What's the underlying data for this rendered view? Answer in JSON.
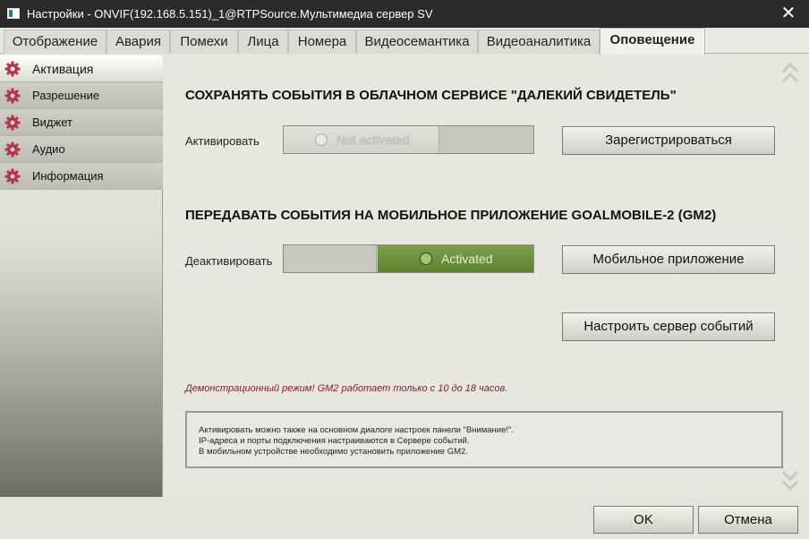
{
  "window": {
    "title": "Настройки - ONVIF(192.168.5.151)_1@RTPSource.Мультимедиа сервер SV",
    "close": "✕"
  },
  "tabs": [
    {
      "label": "Отображение"
    },
    {
      "label": "Авария"
    },
    {
      "label": "Помехи"
    },
    {
      "label": "Лица"
    },
    {
      "label": "Номера"
    },
    {
      "label": "Видеосемантика"
    },
    {
      "label": "Видеоаналитика"
    },
    {
      "label": "Оповещение",
      "active": true
    }
  ],
  "sidebar": {
    "items": [
      {
        "label": "Активация",
        "icon": "gear-icon",
        "active": true
      },
      {
        "label": "Разрешение",
        "icon": "gear-icon"
      },
      {
        "label": "Виджет",
        "icon": "gear-icon"
      },
      {
        "label": "Аудио",
        "icon": "gear-icon"
      },
      {
        "label": "Информация",
        "icon": "gear-icon"
      }
    ]
  },
  "main": {
    "cloud": {
      "title": "СОХРАНЯТЬ СОБЫТИЯ В ОБЛАЧНОМ СЕРВИСЕ \"ДАЛЕКИЙ СВИДЕТЕЛЬ\"",
      "row_label": "Активировать",
      "toggle_text": "Not activated",
      "button": "Зарегистрироваться"
    },
    "mobile": {
      "title": "ПЕРЕДАВАТЬ СОБЫТИЯ НА МОБИЛЬНОЕ ПРИЛОЖЕНИЕ GOALMOBILE-2 (GM2)",
      "row_label": "Деактивировать",
      "toggle_text": "Activated",
      "button": "Мобильное приложение",
      "server_button": "Настроить сервер событий"
    },
    "demo_note": "Демонстрационный режим! GM2 работает только с 10 до 18 часов.",
    "info": {
      "line1": "Активировать можно также на основном диалоге настроек панели \"Внимание!\".",
      "line2": "IP-адреса и порты подключения настраиваются в Сервере событий.",
      "line3": "В мобильном устройстве необходимо установить приложение GM2."
    }
  },
  "footer": {
    "ok": "OK",
    "cancel": "Отмена"
  },
  "colors": {
    "accent_gear": "#b3364a",
    "active_green": "#6b8e3a",
    "demo_text": "#8b1a1a",
    "titlebar": "#2b2b2b"
  }
}
